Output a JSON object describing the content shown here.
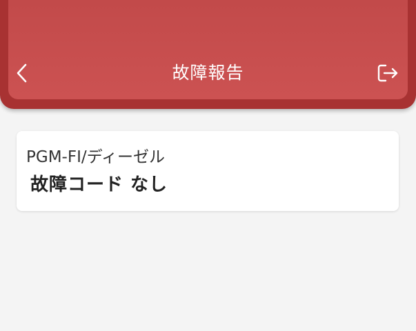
{
  "header": {
    "title": "故障報告",
    "back_icon": "chevron-left-icon",
    "logout_icon": "logout-icon",
    "color": "#c24a4a"
  },
  "card": {
    "label": "PGM-FI/ディーゼル",
    "value": "故障コード なし"
  }
}
